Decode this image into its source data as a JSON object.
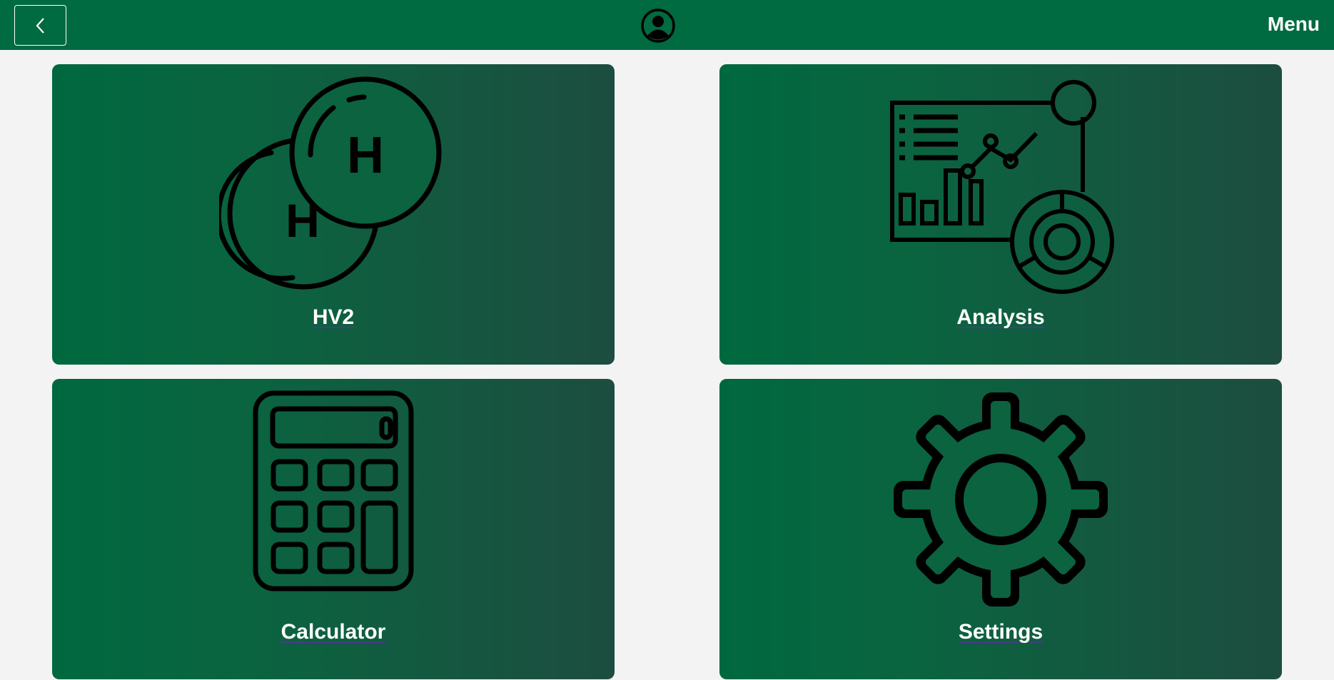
{
  "header": {
    "back_icon": "chevron-left-icon",
    "avatar_icon": "user-account-icon",
    "menu_label": "Menu",
    "bar_color": "#006a40"
  },
  "tiles": [
    {
      "label": "HV2",
      "icon": "hydrogen-molecule-icon"
    },
    {
      "label": "Analysis",
      "icon": "analytics-dashboard-icon"
    },
    {
      "label": "Calculator",
      "icon": "calculator-icon"
    },
    {
      "label": "Settings",
      "icon": "gear-icon"
    }
  ]
}
